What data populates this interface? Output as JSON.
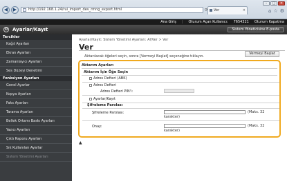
{
  "browser": {
    "url": "http://192.168.1.24/rui_import_dev_rmng_export.html",
    "tab_title": "Ver",
    "win_min": "–",
    "win_max": "□",
    "win_close": "✕",
    "back": "◀",
    "forward": "▶"
  },
  "topbar": {
    "home": "Ana Giriş",
    "user_label": "Oturum Açan Kullanıcı:",
    "user_value": "7654321",
    "logout": "Oturum Kapatma"
  },
  "header": {
    "title": "Ayarlar/Kayıt",
    "portal_button": "Sistem Yöneticisine E-posta"
  },
  "sidebar": {
    "sections": [
      {
        "heading": "Tercihler",
        "items": [
          "Kağıt Ayarları",
          "Ekran Ayarları",
          "Zamanlayıcı Ayarları",
          "Ses Düzeyi Denetimi"
        ]
      },
      {
        "heading": "Fonksiyon Ayarları",
        "items": [
          "Genel Ayarlar",
          "Kopya Ayarları",
          "Faks Ayarları",
          "Tarama Ayarları",
          "Bellek Ortamı Baskı Ayarları",
          "Yazıcı Ayarları",
          "Çıktı Raporu Ayarları",
          "Sık Kullanılan Ayarlar",
          "Sistem Yönetimi Ayarları"
        ]
      }
    ]
  },
  "main": {
    "breadcrumb": "Ayarlar/Kayıt: Sistem Yönetimi Ayarları: Al/Ver > Ver",
    "title": "Ver",
    "instruction": "Aktarılacak öğeleri seçin, sonra [Vermeyi Başlat] seçeneğine tıklayın.",
    "start_button": "Vermeyi Başlat",
    "export_settings_title": "Aktarım Ayarları",
    "select_items_title": "Aktarım İçin Öğe Seçin",
    "cb_address_abk": "Adres Defteri (ABK)",
    "cb_address": "Adres Defteri",
    "address_pin_label": "Adres Defteri PIN'i:",
    "cb_settings": "Ayarlar/Kayıt",
    "encryption_title": "Şifreleme Parolası",
    "enc_password_label": "Şifreleme Parolası:",
    "confirm_label": "Onay:",
    "max_note_1": "(Maks. 32",
    "max_note_2": "karakter)",
    "back_to_top": "▲"
  }
}
